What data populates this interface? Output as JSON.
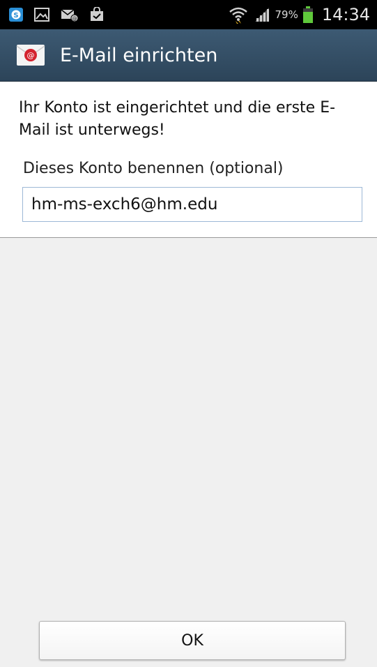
{
  "status_bar": {
    "left_icons": [
      "skype-icon",
      "gallery-icon",
      "missed-mail-icon",
      "shopping-bag-icon"
    ],
    "battery_percent": "79%",
    "time": "14:34"
  },
  "action_bar": {
    "title": "E-Mail einrichten"
  },
  "content": {
    "message": "Ihr Konto ist eingerichtet und die erste E-Mail ist unterwegs!",
    "name_label": "Dieses Konto benennen (optional)",
    "name_value": "hm-ms-exch6@hm.edu"
  },
  "footer": {
    "ok_label": "OK"
  },
  "colors": {
    "action_bar": "#34506a",
    "accent_battery": "#5fc83b",
    "field_border": "#9db8d6"
  }
}
